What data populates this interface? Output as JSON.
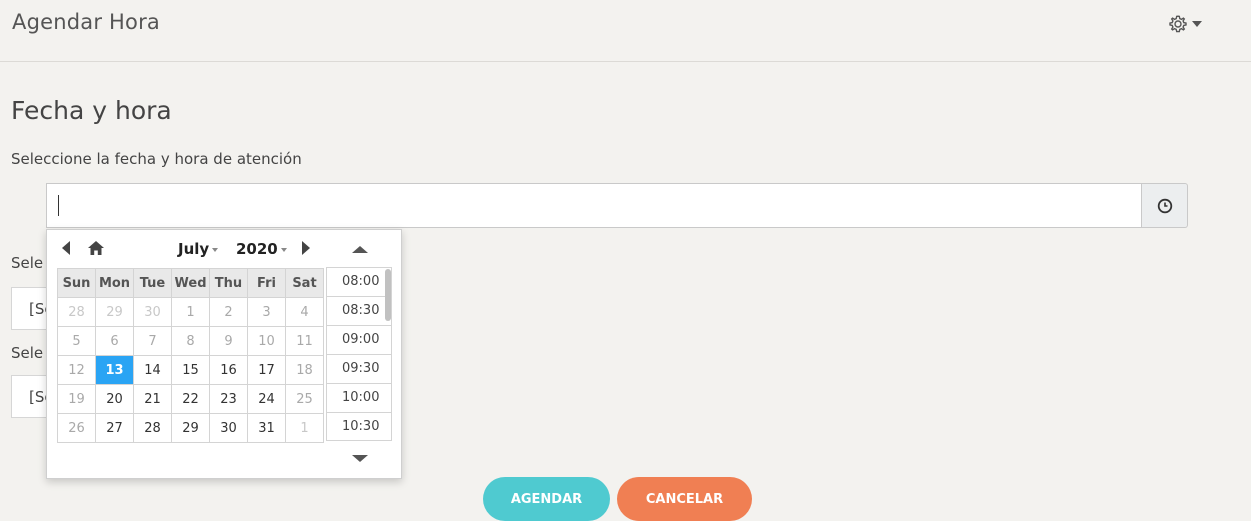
{
  "header": {
    "title": "Agendar Hora"
  },
  "icons": {
    "settings": "gear-icon",
    "settings_caret": "caret-down-icon",
    "clock": "clock-icon",
    "home": "home-icon"
  },
  "section": {
    "title": "Fecha y hora"
  },
  "datetime_field": {
    "label": "Seleccione la fecha y hora de atención",
    "value": "",
    "placeholder": ""
  },
  "behind": {
    "label1": "Sele",
    "select1": "[Se",
    "label2": "Sele",
    "select2": "[Se"
  },
  "picker": {
    "month": "July",
    "year": "2020",
    "weekdays": [
      "Sun",
      "Mon",
      "Tue",
      "Wed",
      "Thu",
      "Fri",
      "Sat"
    ],
    "weeks": [
      [
        {
          "d": "28",
          "s": "other"
        },
        {
          "d": "29",
          "s": "other"
        },
        {
          "d": "30",
          "s": "other"
        },
        {
          "d": "1",
          "s": "disabled"
        },
        {
          "d": "2",
          "s": "disabled"
        },
        {
          "d": "3",
          "s": "disabled"
        },
        {
          "d": "4",
          "s": "disabled"
        }
      ],
      [
        {
          "d": "5",
          "s": "disabled"
        },
        {
          "d": "6",
          "s": "disabled"
        },
        {
          "d": "7",
          "s": "disabled"
        },
        {
          "d": "8",
          "s": "disabled"
        },
        {
          "d": "9",
          "s": "disabled"
        },
        {
          "d": "10",
          "s": "disabled"
        },
        {
          "d": "11",
          "s": "disabled"
        }
      ],
      [
        {
          "d": "12",
          "s": "disabled"
        },
        {
          "d": "13",
          "s": "selected"
        },
        {
          "d": "14",
          "s": "active"
        },
        {
          "d": "15",
          "s": "active"
        },
        {
          "d": "16",
          "s": "active"
        },
        {
          "d": "17",
          "s": "active"
        },
        {
          "d": "18",
          "s": "disabled"
        }
      ],
      [
        {
          "d": "19",
          "s": "disabled"
        },
        {
          "d": "20",
          "s": "active"
        },
        {
          "d": "21",
          "s": "active"
        },
        {
          "d": "22",
          "s": "active"
        },
        {
          "d": "23",
          "s": "active"
        },
        {
          "d": "24",
          "s": "active"
        },
        {
          "d": "25",
          "s": "disabled"
        }
      ],
      [
        {
          "d": "26",
          "s": "disabled"
        },
        {
          "d": "27",
          "s": "active"
        },
        {
          "d": "28",
          "s": "active"
        },
        {
          "d": "29",
          "s": "active"
        },
        {
          "d": "30",
          "s": "active"
        },
        {
          "d": "31",
          "s": "active"
        },
        {
          "d": "1",
          "s": "other"
        }
      ]
    ],
    "times": [
      "08:00",
      "08:30",
      "09:00",
      "09:30",
      "10:00",
      "10:30"
    ]
  },
  "buttons": {
    "agendar": "AGENDAR",
    "cancelar": "CANCELAR"
  },
  "colors": {
    "selected_day": "#2aa4f4",
    "agendar": "#4fcad0",
    "cancelar": "#f07f53",
    "background": "#f3f2ef"
  }
}
